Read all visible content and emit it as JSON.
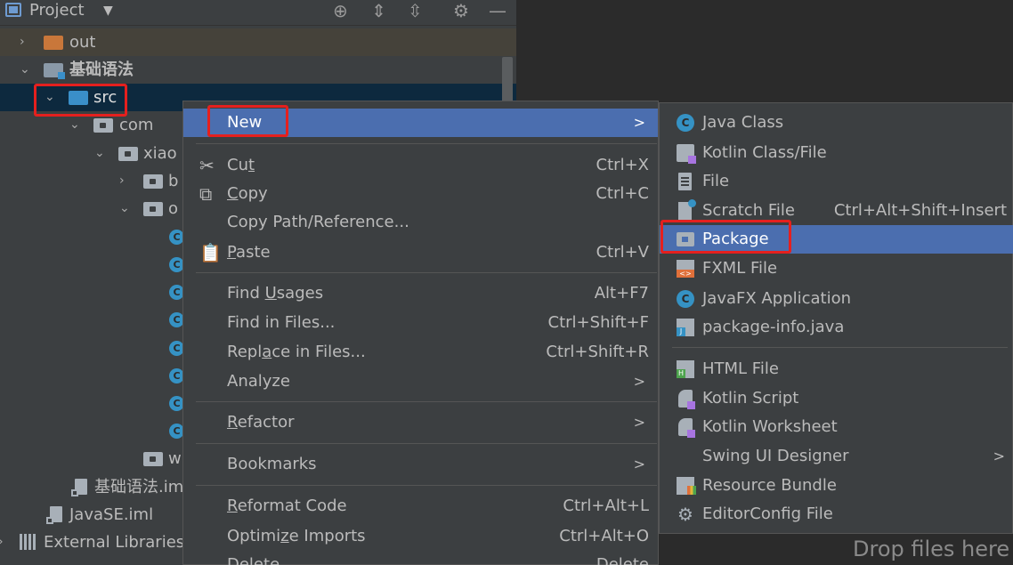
{
  "header": {
    "title": "Project"
  },
  "tree": {
    "out": "out",
    "module": "基础语法",
    "src": "src",
    "com": "com",
    "xiao": "xiao",
    "b": "b",
    "o": "o",
    "w": "w",
    "module_iml": "基础语法.im",
    "javase_iml": "JavaSE.iml",
    "external_libraries": "External Libraries"
  },
  "context_menu": {
    "new": "New",
    "cut": {
      "pre": "Cu",
      "u": "t",
      "post": "",
      "shortcut": "Ctrl+X"
    },
    "copy": {
      "pre": "",
      "u": "C",
      "post": "opy",
      "shortcut": "Ctrl+C"
    },
    "copy_path": "Copy Path/Reference...",
    "paste": {
      "pre": "",
      "u": "P",
      "post": "aste",
      "shortcut": "Ctrl+V"
    },
    "find_usages": {
      "pre": "Find ",
      "u": "U",
      "post": "sages",
      "shortcut": "Alt+F7"
    },
    "find_in_files": {
      "label": "Find in Files...",
      "shortcut": "Ctrl+Shift+F"
    },
    "replace_in_files": {
      "pre": "Repl",
      "u": "a",
      "post": "ce in Files...",
      "shortcut": "Ctrl+Shift+R"
    },
    "analyze": "Analyze",
    "refactor": {
      "pre": "",
      "u": "R",
      "post": "efactor"
    },
    "bookmarks": "Bookmarks",
    "reformat_code": {
      "pre": "",
      "u": "R",
      "post": "eformat Code",
      "shortcut": "Ctrl+Alt+L"
    },
    "optimize_imports": {
      "pre": "Optimi",
      "u": "z",
      "post": "e Imports",
      "shortcut": "Ctrl+Alt+O"
    },
    "delete": {
      "label": "Delete",
      "shortcut": "Delete"
    }
  },
  "submenu": {
    "java_class": "Java Class",
    "kotlin_class": "Kotlin Class/File",
    "file": "File",
    "scratch_file": {
      "label": "Scratch File",
      "shortcut": "Ctrl+Alt+Shift+Insert"
    },
    "package": "Package",
    "fxml_file": "FXML File",
    "javafx_app": "JavaFX Application",
    "package_info": "package-info.java",
    "html_file": "HTML File",
    "kotlin_script": "Kotlin Script",
    "kotlin_worksheet": "Kotlin Worksheet",
    "swing_ui_designer": "Swing UI Designer",
    "resource_bundle": "Resource Bundle",
    "editorconfig_file": "EditorConfig File"
  },
  "editor": {
    "drop_hint": "Drop files here"
  },
  "icons": {
    "class": "C",
    "chevron_right": "›",
    "chevron_down": "⌄",
    "submenu_arrow": ">",
    "cut": "✂",
    "copy": "⧉",
    "paste": "📋",
    "gear": "⚙",
    "dropdown": "▼",
    "locate": "⊕",
    "expand": "⇕",
    "collapse": "⇳",
    "minimize": "—"
  },
  "colors": {
    "highlight": "#4b6eaf",
    "annotation_red": "#e5201e",
    "selection_src": "#0d293e"
  }
}
